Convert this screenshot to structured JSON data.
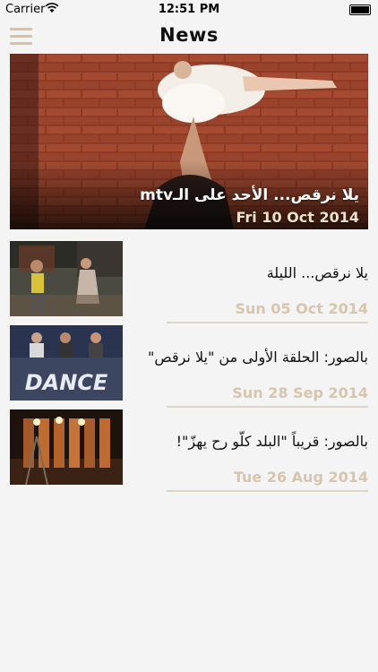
{
  "status_bar": {
    "carrier": "Carrier",
    "time": "12:51 PM"
  },
  "nav": {
    "title": "News",
    "menu_icon": "hamburger-icon"
  },
  "hero": {
    "title": "يلا نرقص... الأحد على الـmtv",
    "date": "Fri 10 Oct 2014"
  },
  "items": [
    {
      "title": "يلا نرقص... الليلة",
      "date": "Sun 05 Oct 2014"
    },
    {
      "title": "بالصور: الحلقة الأولى من \"يلا نرقص\"",
      "date": "Sun 28 Sep 2014"
    },
    {
      "title": "بالصور: قريباً \"البلد كلّو رح يهزّ\"!",
      "date": "Tue 26 Aug 2014"
    }
  ],
  "colors": {
    "accent": "#d8c2a6",
    "date": "#d7c5ae",
    "background": "#f4f4f4"
  }
}
